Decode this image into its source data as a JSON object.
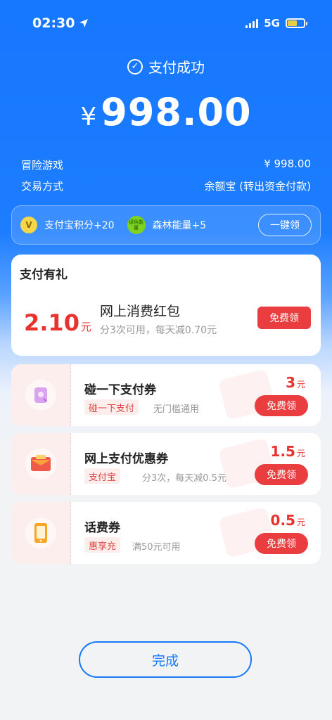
{
  "status_bar": {
    "time": "02:30",
    "network": "5G"
  },
  "header": {
    "status_text": "支付成功",
    "currency": "¥",
    "amount": "998.00"
  },
  "details": [
    {
      "label": "冒险游戏",
      "value": "¥ 998.00"
    },
    {
      "label": "交易方式",
      "value": "余额宝 (转出资金付款)"
    }
  ],
  "rewards": {
    "coin_badge": "V",
    "points": "支付宝积分+20",
    "energy_badge": "绿色能量",
    "energy": "森林能量+5",
    "claim_all_label": "一键领"
  },
  "gift": {
    "section_title": "支付有礼",
    "amount": "2.10",
    "unit": "元",
    "name": "网上消费红包",
    "desc": "分3次可用，每天减0.70元",
    "button": "免费领"
  },
  "coupons": [
    {
      "title": "碰一下支付券",
      "tag": "碰一下支付",
      "desc": "无门槛通用",
      "value": "3",
      "unit": "元",
      "button": "免费领",
      "icon": "nfc-card-icon"
    },
    {
      "title": "网上支付优惠券",
      "tag": "支付宝",
      "desc": "分3次，每天减0.5元",
      "value": "1.5",
      "unit": "元",
      "button": "免费领",
      "icon": "red-envelope-icon"
    },
    {
      "title": "话费券",
      "tag": "惠享充",
      "desc": "满50元可用",
      "value": "0.5",
      "unit": "元",
      "button": "免费领",
      "icon": "phone-icon"
    }
  ],
  "done_label": "完成",
  "colors": {
    "brand_blue": "#1677ff",
    "accent_red": "#ea3d3f"
  }
}
